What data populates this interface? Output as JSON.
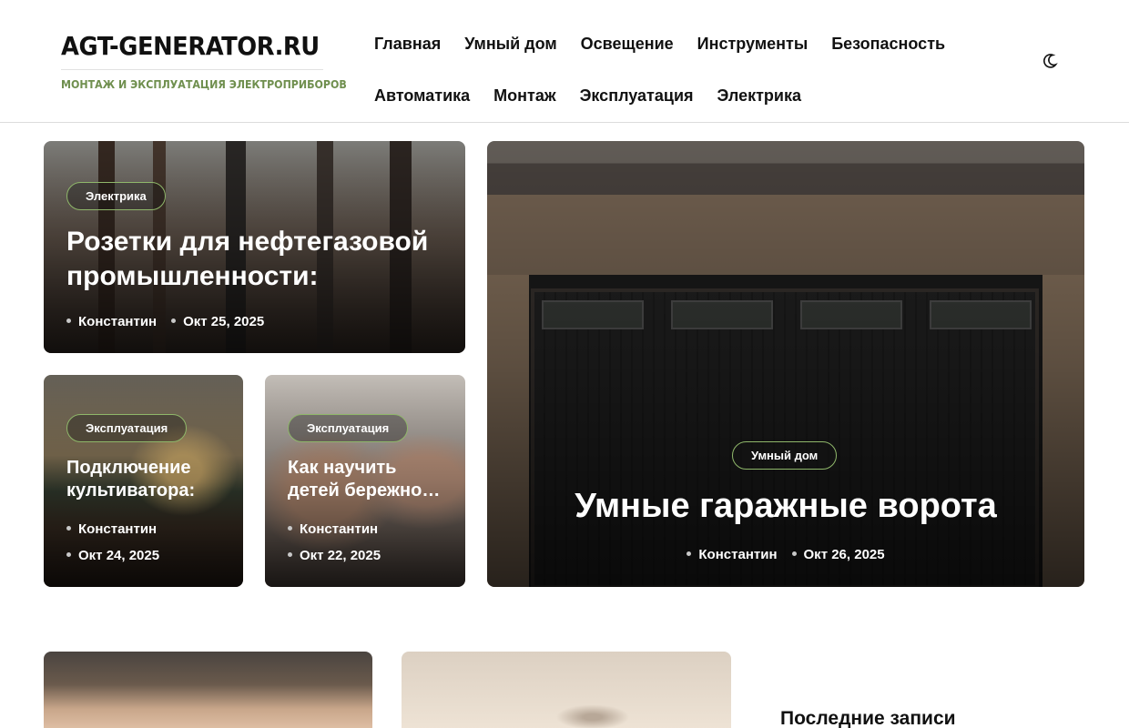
{
  "site": {
    "title": "AGT-GENERATOR.RU",
    "tagline": "МОНТАЖ И ЭКСПЛУАТАЦИЯ ЭЛЕКТРОПРИБОРОВ"
  },
  "nav": {
    "row1": [
      "Главная",
      "Умный дом",
      "Освещение",
      "Инструменты",
      "Безопасность"
    ],
    "row2": [
      "Автоматика",
      "Монтаж",
      "Эксплуатация",
      "Электрика"
    ]
  },
  "posts": [
    {
      "category": "Электрика",
      "title_line1": "Розетки для нефтегазовой",
      "title_line2": "промышленности:",
      "author": "Константин",
      "date": "Окт 25, 2025"
    },
    {
      "category": "Эксплуатация",
      "title_line1": "Подключение",
      "title_line2": "культиватора:",
      "author": "Константин",
      "date": "Окт 24, 2025"
    },
    {
      "category": "Эксплуатация",
      "title_line1": "Как научить",
      "title_line2": "детей бережно…",
      "author": "Константин",
      "date": "Окт 22, 2025"
    },
    {
      "category": "Умный дом",
      "title_line1": "Умные гаражные ворота",
      "author": "Константин",
      "date": "Окт 26, 2025"
    }
  ],
  "sidebar": {
    "recent_title": "Последние записи"
  },
  "colors": {
    "accent_green": "#6f8f4e",
    "pill_border": "#8fb76a"
  }
}
